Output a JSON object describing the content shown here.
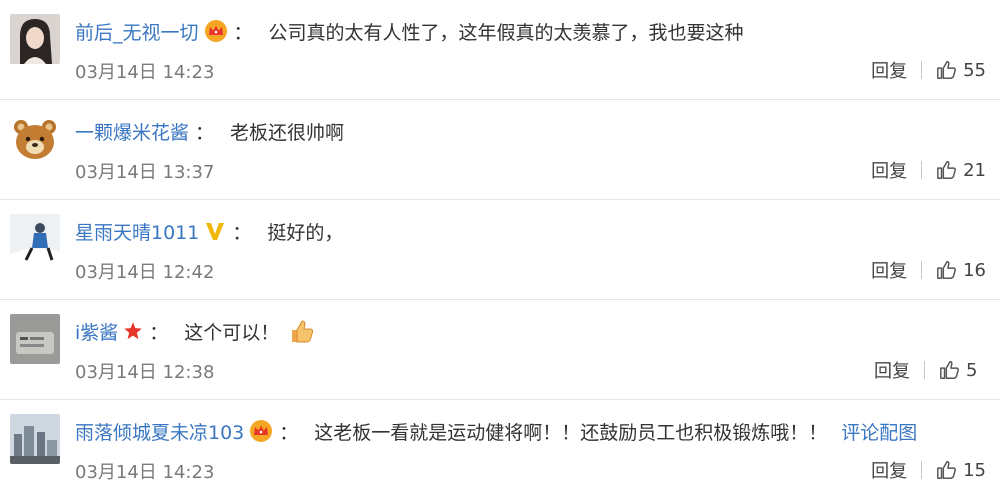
{
  "comments": [
    {
      "username": "前后_无视一切",
      "badge": "crown-badge-icon",
      "colon": "：",
      "text": "公司真的太有人性了，这年假真的太羡慕了，我也要这种",
      "time": "03月14日 14:23",
      "reply_label": "回复",
      "likes": "55",
      "avatar": "portrait-photo"
    },
    {
      "username": "一颗爆米花酱",
      "badge": "",
      "colon": "：",
      "text": "老板还很帅啊",
      "time": "03月14日 13:37",
      "reply_label": "回复",
      "likes": "21",
      "avatar": "bear-avatar"
    },
    {
      "username": "星雨天晴1011",
      "badge": "verified-v-icon",
      "colon": "：",
      "text": "挺好的，",
      "time": "03月14日 12:42",
      "reply_label": "回复",
      "likes": "16",
      "avatar": "snow-figure-photo"
    },
    {
      "username": "i紫酱",
      "badge": "red-star-icon",
      "colon": "：",
      "text": "这个可以！",
      "emoji": "thumbs-up-emoji",
      "time": "03月14日 12:38",
      "reply_label": "回复",
      "likes": "5",
      "avatar": "gray-photo"
    },
    {
      "username": "雨落倾城夏未凉103",
      "badge": "crown-badge-icon",
      "colon": "：",
      "text": "这老板一看就是运动健将啊！！还鼓励员工也积极锻炼哦！！",
      "link": "评论配图",
      "time": "03月14日 14:23",
      "reply_label": "回复",
      "likes": "15",
      "avatar": "city-photo"
    }
  ],
  "colors": {
    "username": "#3a77c2",
    "text": "#333333",
    "time": "#7a7a7a",
    "divider": "#e6e6e6",
    "crown_gold": "#f5a623",
    "verified": "#f2b705",
    "star_red": "#e8352a"
  }
}
